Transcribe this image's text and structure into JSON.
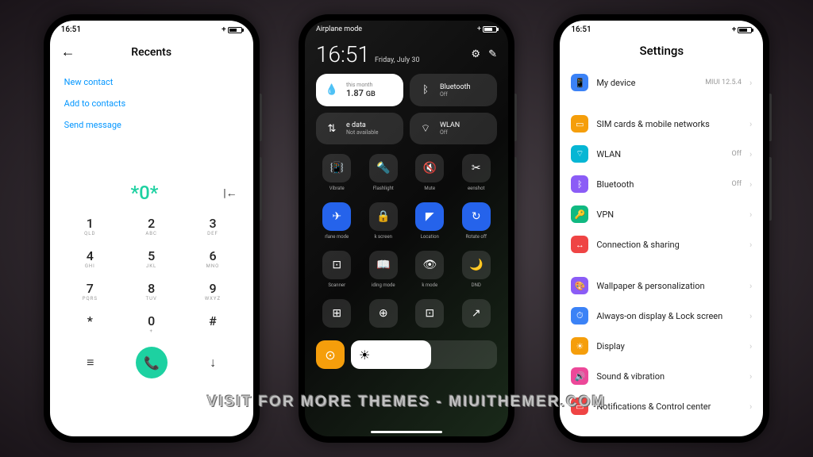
{
  "statusbar": {
    "time": "16:51"
  },
  "phone1": {
    "title": "Recents",
    "actions": [
      "New contact",
      "Add to contacts",
      "Send message"
    ],
    "number": "*0*",
    "keys": [
      {
        "n": "1",
        "s": "QLD"
      },
      {
        "n": "2",
        "s": "ABC"
      },
      {
        "n": "3",
        "s": "DEF"
      },
      {
        "n": "4",
        "s": "GHI"
      },
      {
        "n": "5",
        "s": "JKL"
      },
      {
        "n": "6",
        "s": "MNO"
      },
      {
        "n": "7",
        "s": "PQRS"
      },
      {
        "n": "8",
        "s": "TUV"
      },
      {
        "n": "9",
        "s": "WXYZ"
      },
      {
        "n": "*",
        "s": ""
      },
      {
        "n": "0",
        "s": "+"
      },
      {
        "n": "#",
        "s": ""
      }
    ]
  },
  "phone2": {
    "mode": "Airplane mode",
    "clock": "16:51",
    "date": "Friday, July 30",
    "tiles": [
      {
        "label": "this month",
        "val": "1.87",
        "unit": "GB",
        "white": true,
        "icon": "💧"
      },
      {
        "label": "Bluetooth",
        "sub": "Off",
        "icon": "ᛒ"
      },
      {
        "label": "e data",
        "sub": "Not available",
        "icon": "⇅"
      },
      {
        "label": "WLAN",
        "sub": "Off",
        "icon": "⌔"
      }
    ],
    "grid": [
      {
        "icon": "📳",
        "label": "Vibrate"
      },
      {
        "icon": "🔦",
        "label": "Flashlight"
      },
      {
        "icon": "🔇",
        "label": "Mute"
      },
      {
        "icon": "✂",
        "label": "eenshot"
      },
      {
        "icon": "✈",
        "label": "rlane mode",
        "active": true
      },
      {
        "icon": "🔒",
        "label": "k screen"
      },
      {
        "icon": "◤",
        "label": "Location",
        "active": true
      },
      {
        "icon": "↻",
        "label": "Rotate off",
        "active": true
      },
      {
        "icon": "⊡",
        "label": "Scanner"
      },
      {
        "icon": "📖",
        "label": "iding mode"
      },
      {
        "icon": "👁",
        "label": "k mode"
      },
      {
        "icon": "🌙",
        "label": "DND"
      },
      {
        "icon": "⊞",
        "label": ""
      },
      {
        "icon": "⊕",
        "label": ""
      },
      {
        "icon": "⊡",
        "label": ""
      },
      {
        "icon": "↗",
        "label": ""
      }
    ]
  },
  "phone3": {
    "title": "Settings",
    "sections": [
      [
        {
          "icon": "📱",
          "cls": "ic-blue",
          "label": "My device",
          "val": "MIUI 12.5.4"
        }
      ],
      [
        {
          "icon": "▭",
          "cls": "ic-yellow",
          "label": "SIM cards & mobile networks"
        },
        {
          "icon": "⌔",
          "cls": "ic-cyan",
          "label": "WLAN",
          "val": "Off"
        },
        {
          "icon": "ᛒ",
          "cls": "ic-purple",
          "label": "Bluetooth",
          "val": "Off"
        },
        {
          "icon": "🔑",
          "cls": "ic-green",
          "label": "VPN"
        },
        {
          "icon": "↔",
          "cls": "ic-red",
          "label": "Connection & sharing"
        }
      ],
      [
        {
          "icon": "🎨",
          "cls": "ic-purple",
          "label": "Wallpaper & personalization"
        },
        {
          "icon": "⏱",
          "cls": "ic-blue",
          "label": "Always-on display & Lock screen"
        },
        {
          "icon": "☀",
          "cls": "ic-yellow",
          "label": "Display"
        },
        {
          "icon": "🔊",
          "cls": "ic-pink",
          "label": "Sound & vibration"
        },
        {
          "icon": "▭",
          "cls": "ic-red",
          "label": "Notifications & Control center"
        }
      ]
    ]
  },
  "watermark": "VISIT FOR MORE THEMES - MIUITHEMER.COM"
}
